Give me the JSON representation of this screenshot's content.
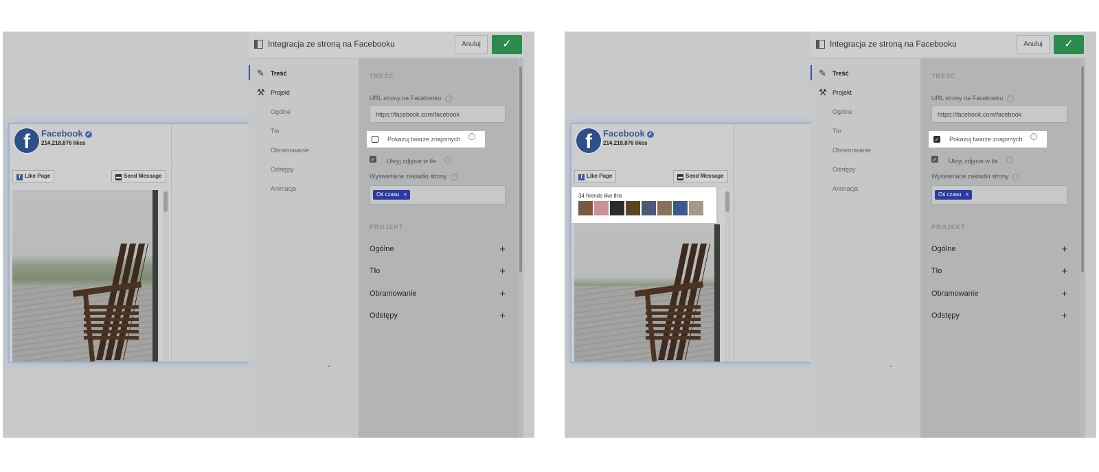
{
  "colors": {
    "accent": "#2d3a9e",
    "ok_button": "#2e8b4e",
    "fb_blue": "#3b5a94"
  },
  "facebook": {
    "name": "Facebook",
    "likes": "214,218,876 likes",
    "like_page": "Like Page",
    "send_message": "Send Message",
    "friends_text": "34 friends like this"
  },
  "panel": {
    "title": "Integracja ze stroną na Facebooku",
    "cancel": "Anuluj",
    "ok_icon": "check-icon",
    "nav": {
      "tresc": "Treść",
      "projekt": "Projekt",
      "sub": [
        "Ogólne",
        "Tło",
        "Obramowanie",
        "Odstępy",
        "Animacja"
      ]
    },
    "content": {
      "section_tresc": "TREŚĆ",
      "url_label": "URL strony na Facebooku",
      "url_value": "https://facebook.com/facebook",
      "show_faces": "Pokazuj twarze znajomych",
      "hide_cover": "Ukryj zdjęcie w tle",
      "tabs_label": "Wyświetlane zakładki strony",
      "tab_tag": "Oś czasu",
      "tag_remove": "×",
      "section_projekt": "PROJEKT",
      "accordion": [
        "Ogólne",
        "Tło",
        "Obramowanie",
        "Odstępy"
      ],
      "plus": "+"
    }
  },
  "screens": [
    {
      "show_faces_checked": false,
      "hide_cover_checked": true
    },
    {
      "show_faces_checked": true,
      "hide_cover_checked": true
    }
  ]
}
